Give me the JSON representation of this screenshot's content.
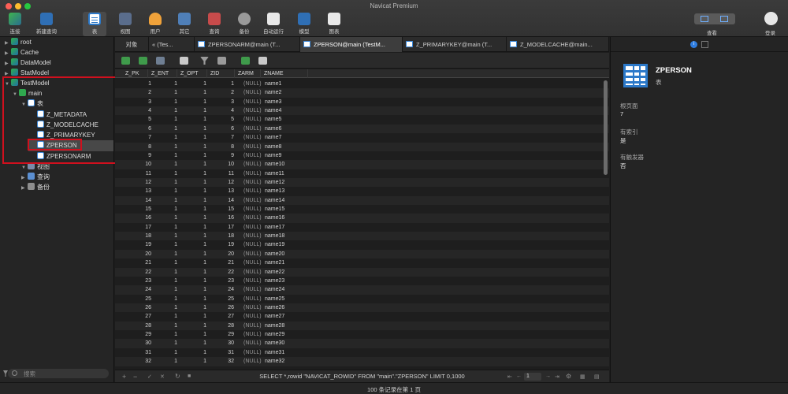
{
  "window": {
    "title": "Navicat Premium"
  },
  "toolbar": {
    "buttons": [
      {
        "id": "connect",
        "label": "连接"
      },
      {
        "id": "new_query",
        "label": "新建查询"
      },
      {
        "id": "table",
        "label": "表"
      },
      {
        "id": "view",
        "label": "视图"
      },
      {
        "id": "user",
        "label": "用户"
      },
      {
        "id": "other",
        "label": "其它"
      },
      {
        "id": "query",
        "label": "查询"
      },
      {
        "id": "backup",
        "label": "备份"
      },
      {
        "id": "automation",
        "label": "自动运行"
      },
      {
        "id": "model",
        "label": "模型"
      },
      {
        "id": "chart",
        "label": "图表"
      }
    ],
    "view_label": "查看",
    "login_label": "登录"
  },
  "sidebar": {
    "items": [
      {
        "label": "root"
      },
      {
        "label": "Cache"
      },
      {
        "label": "DataModel"
      },
      {
        "label": "StatModel"
      },
      {
        "label": "TestModel"
      },
      {
        "label": "main"
      },
      {
        "label": "表"
      },
      {
        "label": "Z_METADATA"
      },
      {
        "label": "Z_MODELCACHE"
      },
      {
        "label": "Z_PRIMARYKEY"
      },
      {
        "label": "ZPERSON"
      },
      {
        "label": "ZPERSONARM"
      },
      {
        "label": "视图"
      },
      {
        "label": "查询"
      },
      {
        "label": "备份"
      }
    ],
    "search_placeholder": "搜索"
  },
  "tabs": [
    {
      "label": "对象"
    },
    {
      "label": "« (Tes..."
    },
    {
      "label": "ZPERSONARM@main (T..."
    },
    {
      "label": "ZPERSON@main (TestM..."
    },
    {
      "label": "Z_PRIMARYKEY@main (T..."
    },
    {
      "label": "Z_MODELCACHE@main..."
    }
  ],
  "grid": {
    "columns": [
      "Z_PK",
      "Z_ENT",
      "Z_OPT",
      "ZID",
      "ZARM",
      "ZNAME"
    ],
    "null_text": "(NULL)",
    "rows": [
      [
        "1",
        "1",
        "1",
        "1",
        "(NULL)",
        "name1"
      ],
      [
        "2",
        "1",
        "1",
        "2",
        "(NULL)",
        "name2"
      ],
      [
        "3",
        "1",
        "1",
        "3",
        "(NULL)",
        "name3"
      ],
      [
        "4",
        "1",
        "1",
        "4",
        "(NULL)",
        "name4"
      ],
      [
        "5",
        "1",
        "1",
        "5",
        "(NULL)",
        "name5"
      ],
      [
        "6",
        "1",
        "1",
        "6",
        "(NULL)",
        "name6"
      ],
      [
        "7",
        "1",
        "1",
        "7",
        "(NULL)",
        "name7"
      ],
      [
        "8",
        "1",
        "1",
        "8",
        "(NULL)",
        "name8"
      ],
      [
        "9",
        "1",
        "1",
        "9",
        "(NULL)",
        "name9"
      ],
      [
        "10",
        "1",
        "1",
        "10",
        "(NULL)",
        "name10"
      ],
      [
        "11",
        "1",
        "1",
        "11",
        "(NULL)",
        "name11"
      ],
      [
        "12",
        "1",
        "1",
        "12",
        "(NULL)",
        "name12"
      ],
      [
        "13",
        "1",
        "1",
        "13",
        "(NULL)",
        "name13"
      ],
      [
        "14",
        "1",
        "1",
        "14",
        "(NULL)",
        "name14"
      ],
      [
        "15",
        "1",
        "1",
        "15",
        "(NULL)",
        "name15"
      ],
      [
        "16",
        "1",
        "1",
        "16",
        "(NULL)",
        "name16"
      ],
      [
        "17",
        "1",
        "1",
        "17",
        "(NULL)",
        "name17"
      ],
      [
        "18",
        "1",
        "1",
        "18",
        "(NULL)",
        "name18"
      ],
      [
        "19",
        "1",
        "1",
        "19",
        "(NULL)",
        "name19"
      ],
      [
        "20",
        "1",
        "1",
        "20",
        "(NULL)",
        "name20"
      ],
      [
        "21",
        "1",
        "1",
        "21",
        "(NULL)",
        "name21"
      ],
      [
        "22",
        "1",
        "1",
        "22",
        "(NULL)",
        "name22"
      ],
      [
        "23",
        "1",
        "1",
        "23",
        "(NULL)",
        "name23"
      ],
      [
        "24",
        "1",
        "1",
        "24",
        "(NULL)",
        "name24"
      ],
      [
        "25",
        "1",
        "1",
        "25",
        "(NULL)",
        "name25"
      ],
      [
        "26",
        "1",
        "1",
        "26",
        "(NULL)",
        "name26"
      ],
      [
        "27",
        "1",
        "1",
        "27",
        "(NULL)",
        "name27"
      ],
      [
        "28",
        "1",
        "1",
        "28",
        "(NULL)",
        "name28"
      ],
      [
        "29",
        "1",
        "1",
        "29",
        "(NULL)",
        "name29"
      ],
      [
        "30",
        "1",
        "1",
        "30",
        "(NULL)",
        "name30"
      ],
      [
        "31",
        "1",
        "1",
        "31",
        "(NULL)",
        "name31"
      ],
      [
        "32",
        "1",
        "1",
        "32",
        "(NULL)",
        "name32"
      ]
    ]
  },
  "bottom": {
    "sql": "SELECT *,rowid \"NAVICAT_ROWID\" FROM \"main\".\"ZPERSON\" LIMIT 0,1000",
    "page": "1",
    "status": "100 条记录在第 1 页"
  },
  "info": {
    "name": "ZPERSON",
    "type": "表",
    "pages_label": "根页面",
    "pages_value": "7",
    "index_label": "有索引",
    "index_value": "是",
    "trigger_label": "有触发器",
    "trigger_value": "否"
  },
  "colors": {
    "accent": "#2c79c9",
    "highlight_box": "#d0101e",
    "background": "#1e1e1e"
  }
}
